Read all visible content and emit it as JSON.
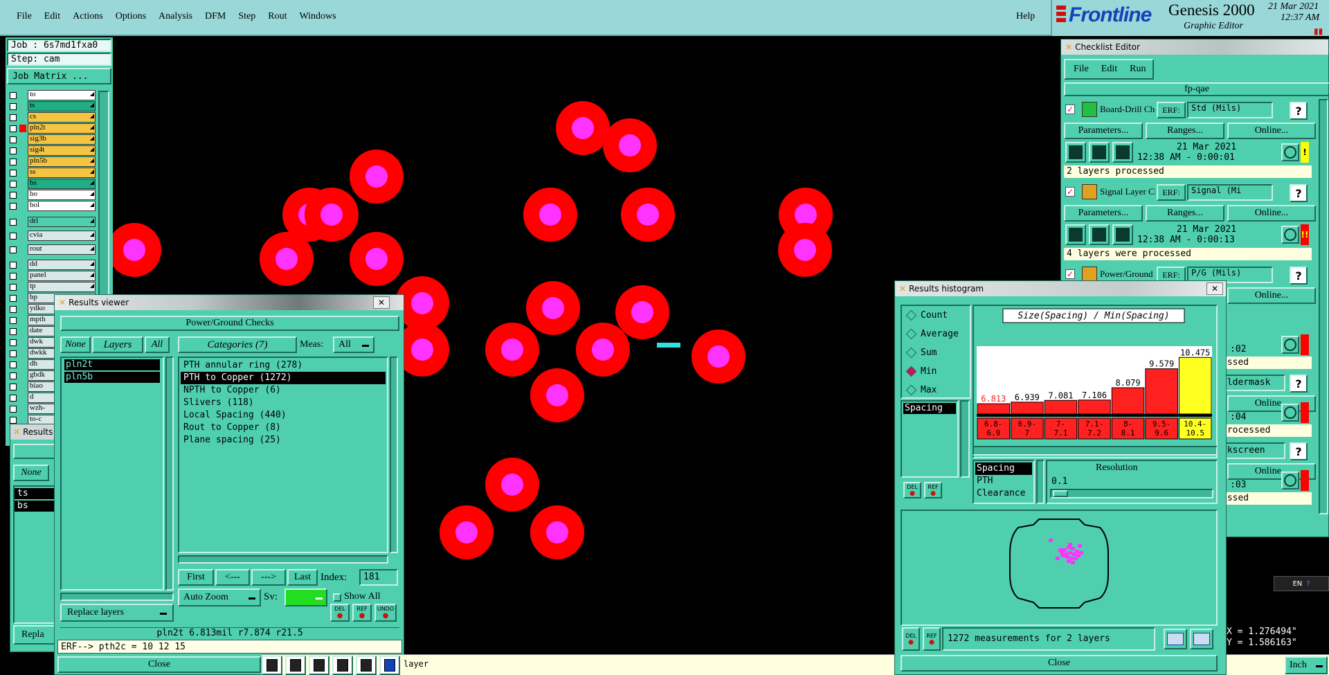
{
  "menubar": {
    "items": [
      "File",
      "Edit",
      "Actions",
      "Options",
      "Analysis",
      "DFM",
      "Step",
      "Rout",
      "Windows"
    ],
    "help": "Help"
  },
  "brand": {
    "logo": "Frontline",
    "product": "Genesis 2000",
    "subtitle": "Graphic Editor",
    "date": "21 Mar 2021",
    "time": "12:37 AM"
  },
  "job": {
    "job_label": "Job : 6s7md1fxa0",
    "step_label": "Step: cam",
    "matrix_button": "Job Matrix ..."
  },
  "layers": [
    {
      "name": "to",
      "color": "#ffffff"
    },
    {
      "name": "ts",
      "color": "#1fae84"
    },
    {
      "name": "cs",
      "color": "#f5c542"
    },
    {
      "name": "pln2t",
      "color": "#f5c542",
      "marker": "#ff0000"
    },
    {
      "name": "sig3b",
      "color": "#f5c542"
    },
    {
      "name": "sig4t",
      "color": "#f5c542"
    },
    {
      "name": "pln5b",
      "color": "#f5c542"
    },
    {
      "name": "ss",
      "color": "#f5c542"
    },
    {
      "name": "bs",
      "color": "#1fae84"
    },
    {
      "name": "bo",
      "color": "#ffffff"
    },
    {
      "name": "bol",
      "color": "#ffffff"
    }
  ],
  "layers2": [
    {
      "name": "drl",
      "color": "#4fcfae"
    },
    {
      "name": "cvia",
      "color": "#d8e8e8"
    },
    {
      "name": "rout",
      "color": "#d8e8e8"
    }
  ],
  "layers3": [
    {
      "name": "dd",
      "color": "#d8e8e8"
    },
    {
      "name": "panel",
      "color": "#d8e8e8"
    },
    {
      "name": "tp",
      "color": "#d8e8e8"
    },
    {
      "name": "bp",
      "color": "#d8e8e8"
    },
    {
      "name": "ydko",
      "color": "#d8e8e8"
    },
    {
      "name": "mpth",
      "color": "#d8e8e8"
    },
    {
      "name": "date",
      "color": "#d8e8e8"
    },
    {
      "name": "dwk",
      "color": "#d8e8e8"
    },
    {
      "name": "dwkk",
      "color": "#d8e8e8"
    },
    {
      "name": "dh",
      "color": "#d8e8e8"
    },
    {
      "name": "gbdk",
      "color": "#d8e8e8"
    },
    {
      "name": "biao",
      "color": "#d8e8e8"
    },
    {
      "name": "d",
      "color": "#d8e8e8"
    },
    {
      "name": "wzh-",
      "color": "#d8e8e8"
    },
    {
      "name": "to-c",
      "color": "#d8e8e8"
    }
  ],
  "results_viewer": {
    "title": "Results viewer",
    "header": "Power/Ground Checks",
    "none_button": "None",
    "layers_button": "Layers",
    "all_button": "All",
    "categories_button": "Categories (7)",
    "meas_label": "Meas:",
    "meas_value": "All",
    "layer_items": [
      "pln2t",
      "pln5b"
    ],
    "categories": [
      "PTH annular ring (278)",
      "PTH to Copper (1272)",
      "NPTH to Copper (6)",
      "Slivers (118)",
      "Local Spacing (440)",
      "Rout to Copper (8)",
      "Plane spacing (25)"
    ],
    "selected_category": 1,
    "first": "First",
    "prev": "<---",
    "next": "--->",
    "last": "Last",
    "index_label": "Index:",
    "index_value": "181",
    "auto_zoom": "Auto Zoom",
    "sv_label": "Sv:",
    "show_all": "Show All",
    "replace_layers": "Replace layers",
    "del": "DEL",
    "ref": "REF",
    "undo": "UNDO",
    "status": "pln2t 6.813mil  r7.874  r21.5",
    "erf": "ERF--> pth2c = 10 12 15",
    "close": "Close"
  },
  "results_viewer_back": {
    "title": "Results",
    "none": "None",
    "items": [
      "ts",
      "bs"
    ],
    "replace": "Repla"
  },
  "bottom_bar": {
    "layer_text": "layer",
    "units": "Inch"
  },
  "coords": {
    "x": "X = 1.276494\"",
    "y": "Y = 1.586163\""
  },
  "checklist": {
    "title": "Checklist Editor",
    "menu": [
      "File",
      "Edit",
      "Run"
    ],
    "name": "fp-qae",
    "checks": [
      {
        "name": "Board-Drill Che",
        "erf_label": "ERF:",
        "erf": "Std (Mils)",
        "params": "Parameters...",
        "ranges": "Ranges...",
        "online": "Online...",
        "date": "21 Mar 2021",
        "time": "12:38 AM - 0:00:01",
        "status": "2 layers processed",
        "flag": "!",
        "flag_color": "#ffff00"
      },
      {
        "name": "Signal Layer Ch",
        "erf_label": "ERF:",
        "erf": "Signal (Mi",
        "params": "Parameters...",
        "ranges": "Ranges...",
        "online": "Online...",
        "date": "21 Mar 2021",
        "time": "12:38 AM - 0:00:13",
        "status": "4 layers were processed",
        "flag": "!!",
        "flag_color": "#ff0000"
      },
      {
        "name": "Power/Ground C",
        "erf_label": "ERF:",
        "erf": "P/G (Mils)",
        "online": "Online..."
      }
    ],
    "partial": [
      {
        "time": ":02",
        "status": "essed",
        "next": "oldermask"
      },
      {
        "time": ":04",
        "status": "processed",
        "next": "lkscreen"
      },
      {
        "time": ":03",
        "status": "essed"
      }
    ],
    "online": "Online..."
  },
  "histogram": {
    "title": "Results histogram",
    "modes": [
      "Count",
      "Average",
      "Sum",
      "Min",
      "Max"
    ],
    "selected_mode": "Min",
    "measure_list": [
      "Spacing"
    ],
    "chart_title": "Size(Spacing) / Min(Spacing)",
    "ranges": [
      {
        "lo": "6.8-",
        "hi": "6.9"
      },
      {
        "lo": "6.9-",
        "hi": "7"
      },
      {
        "lo": "7-",
        "hi": "7.1"
      },
      {
        "lo": "7.1-",
        "hi": "7.2"
      },
      {
        "lo": "8-",
        "hi": "8.1"
      },
      {
        "lo": "9.5-",
        "hi": "9.6"
      },
      {
        "lo": "10.4-",
        "hi": "10.5"
      }
    ],
    "attr_list": [
      "Spacing",
      "PTH",
      "Clearance"
    ],
    "resolution_label": "Resolution",
    "resolution_value": "0.1",
    "summary": "1272 measurements for 2 layers",
    "close": "Close",
    "del": "DEL",
    "ref": "REF"
  },
  "chart_data": {
    "type": "bar",
    "categories": [
      "6.8-6.9",
      "6.9-7",
      "7-7.1",
      "7.1-7.2",
      "8-8.1",
      "9.5-9.6",
      "10.4-10.5"
    ],
    "values": [
      6.813,
      6.939,
      7.081,
      7.106,
      8.079,
      9.579,
      10.475
    ],
    "value_labels": [
      "6.813",
      "6.939",
      "7.081",
      "7.106",
      "8.079",
      "9.579",
      "10.475"
    ],
    "title": "Size(Spacing) / Min(Spacing)",
    "highlighted_index": 6,
    "colors": {
      "bar": "#ff2020",
      "highlight": "#ffff20",
      "min_label": "#ff2020"
    }
  },
  "colors": {
    "pad": "#ff0000",
    "drill": "#ff33ff",
    "marker": "#33e0e0",
    "panel": "#4fcfae",
    "menubar": "#9ad7d8"
  }
}
